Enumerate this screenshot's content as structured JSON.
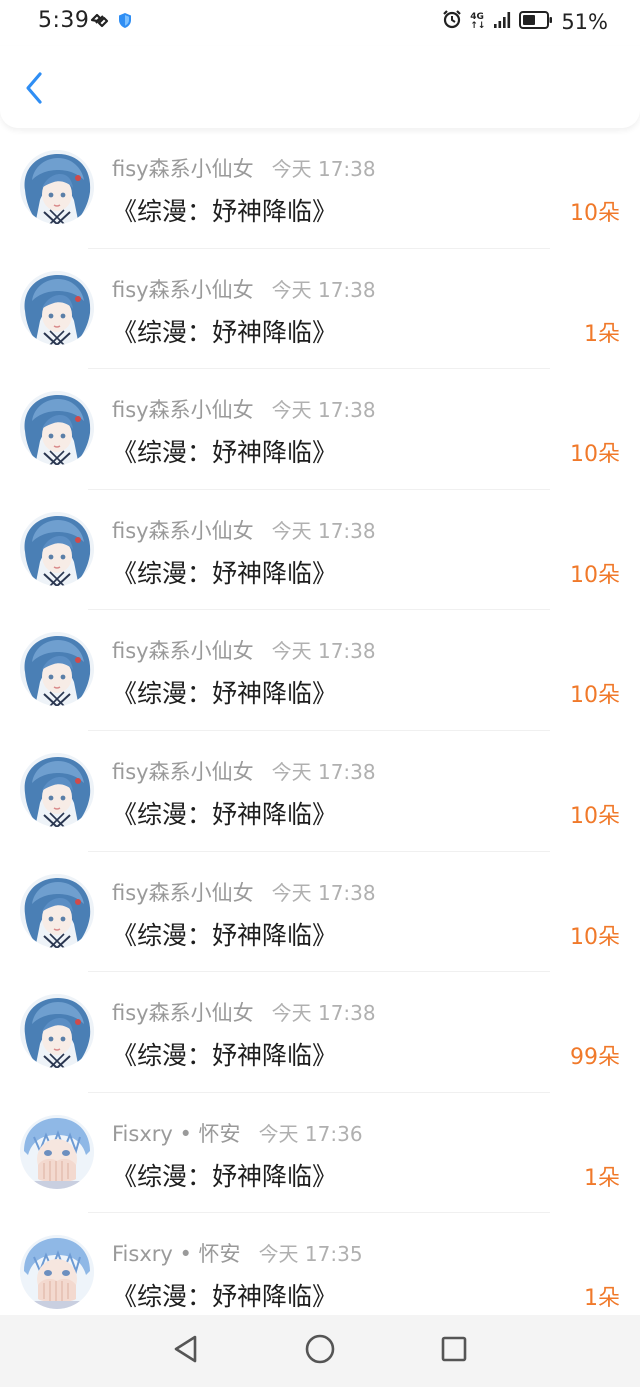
{
  "status_bar": {
    "time": "5:39",
    "network_top": "4G",
    "network_bottom": "↑↓",
    "battery_percent": "51%",
    "icons": [
      "link-icon",
      "shield-icon",
      "alarm-icon",
      "signal-icon",
      "battery-icon"
    ]
  },
  "header": {
    "back_icon": "chevron-left-icon",
    "accent_color": "#2f8ef4"
  },
  "list": {
    "items": [
      {
        "name": "fisy森系小仙女",
        "time": "今天 17:38",
        "title": "《综漫：妤神降临》",
        "amount": "10朵",
        "avatar": "avatar-a"
      },
      {
        "name": "fisy森系小仙女",
        "time": "今天 17:38",
        "title": "《综漫：妤神降临》",
        "amount": "1朵",
        "avatar": "avatar-a"
      },
      {
        "name": "fisy森系小仙女",
        "time": "今天 17:38",
        "title": "《综漫：妤神降临》",
        "amount": "10朵",
        "avatar": "avatar-a"
      },
      {
        "name": "fisy森系小仙女",
        "time": "今天 17:38",
        "title": "《综漫：妤神降临》",
        "amount": "10朵",
        "avatar": "avatar-a"
      },
      {
        "name": "fisy森系小仙女",
        "time": "今天 17:38",
        "title": "《综漫：妤神降临》",
        "amount": "10朵",
        "avatar": "avatar-a"
      },
      {
        "name": "fisy森系小仙女",
        "time": "今天 17:38",
        "title": "《综漫：妤神降临》",
        "amount": "10朵",
        "avatar": "avatar-a"
      },
      {
        "name": "fisy森系小仙女",
        "time": "今天 17:38",
        "title": "《综漫：妤神降临》",
        "amount": "10朵",
        "avatar": "avatar-a"
      },
      {
        "name": "fisy森系小仙女",
        "time": "今天 17:38",
        "title": "《综漫：妤神降临》",
        "amount": "99朵",
        "avatar": "avatar-a"
      },
      {
        "name": "Fisxry • 怀安",
        "time": "今天 17:36",
        "title": "《综漫：妤神降临》",
        "amount": "1朵",
        "avatar": "avatar-b"
      },
      {
        "name": "Fisxry • 怀安",
        "time": "今天 17:35",
        "title": "《综漫：妤神降临》",
        "amount": "1朵",
        "avatar": "avatar-b"
      }
    ],
    "amount_color": "#f0792a"
  },
  "nav_bar": {
    "buttons": [
      "back-triangle-icon",
      "home-circle-icon",
      "recents-square-icon"
    ]
  }
}
